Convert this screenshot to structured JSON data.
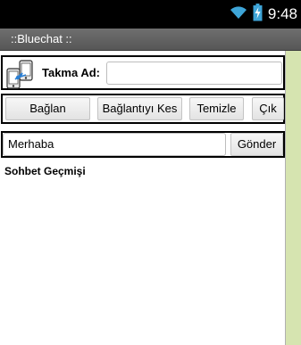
{
  "status_bar": {
    "time": "9:48",
    "wifi_icon": "wifi-icon",
    "battery_icon": "battery-charging-icon"
  },
  "app": {
    "title": "::Bluechat ::"
  },
  "nickname": {
    "icon": "phones-bluetooth-icon",
    "label": "Takma Ad:",
    "value": ""
  },
  "actions": {
    "connect": "Bağlan",
    "disconnect": "Bağlantıyı Kes",
    "clear": "Temizle",
    "exit": "Çık"
  },
  "message": {
    "value": "Merhaba",
    "send": "Gönder"
  },
  "history": {
    "label": "Sohbet Geçmişi"
  },
  "colors": {
    "status_bar": "#000000",
    "title_bar": "#636363",
    "side_strip": "#d6e4b0",
    "row_border": "#000000"
  }
}
